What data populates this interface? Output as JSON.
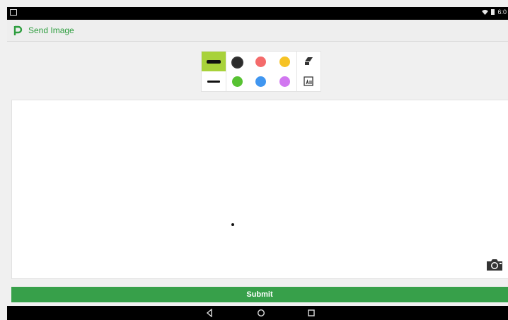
{
  "app": {
    "title": "Send Image"
  },
  "status_bar": {
    "time": "6:0"
  },
  "toolbar": {
    "colors": [
      "#2b2b2b",
      "#f46b6b",
      "#f6c325",
      "#57c232",
      "#4096f0",
      "#d177f0"
    ],
    "selected_color": "#2b2b2b",
    "selected_stroke": "thick",
    "accent_color": "#a8d23a",
    "tools": [
      "eraser-icon",
      "clear-all-icon"
    ]
  },
  "canvas": {
    "camera_icon": "camera-icon"
  },
  "submit": {
    "label": "Submit",
    "color": "#37a04a"
  },
  "nav": [
    "back-icon",
    "home-icon",
    "recents-icon"
  ]
}
